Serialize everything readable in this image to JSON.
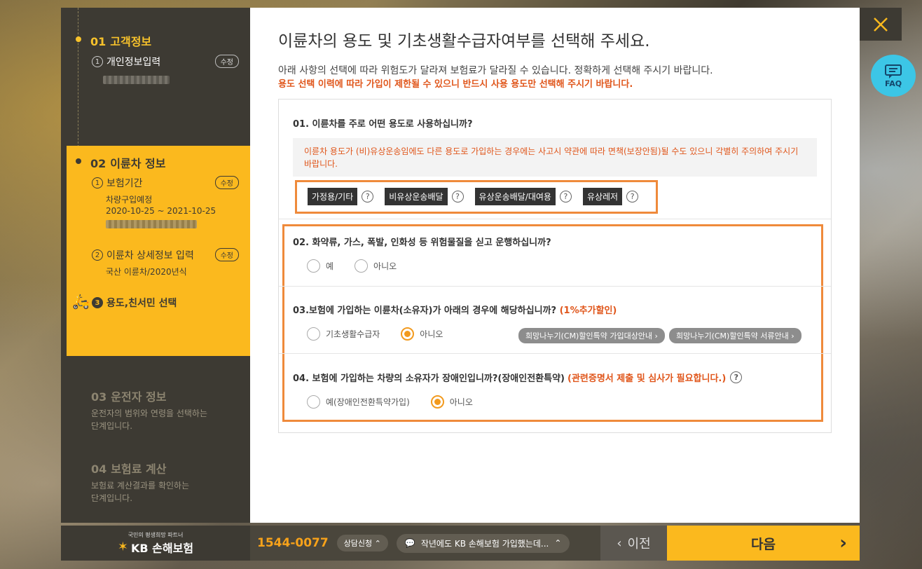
{
  "sidebar": {
    "step1": {
      "num": "01",
      "title": "고객정보",
      "sub_num": "1",
      "sub_label": "개인정보입력",
      "edit": "수정"
    },
    "step2": {
      "num": "02",
      "title": "이륜차 정보",
      "s1_num": "1",
      "s1_label": "보험기간",
      "s1_edit": "수정",
      "s1_line1": "차량구입예정",
      "s1_line2": "2020-10-25 ~ 2021-10-25",
      "s2_num": "2",
      "s2_label": "이륜차 상세정보 입력",
      "s2_edit": "수정",
      "s2_line1": "국산 이륜차/2020년식",
      "s3_num": "3",
      "s3_label": "용도,친서민 선택"
    },
    "step3": {
      "num": "03",
      "title": "운전자 정보",
      "desc1": "운전자의 범위와 연령을 선택하는",
      "desc2": "단계입니다."
    },
    "step4": {
      "num": "04",
      "title": "보험료 계산",
      "desc1": "보험료 계산결과를 확인하는",
      "desc2": "단계입니다."
    }
  },
  "main": {
    "title": "이륜차의 용도 및 기초생활수급자여부를 선택해 주세요.",
    "lead": "아래 사항의 선택에 따라 위험도가 달라져 보험료가 달라질 수 있습니다. 정확하게 선택해 주시기 바랍니다.",
    "lead_warn": "용도 선택 이력에 따라 가입이 제한될 수 있으니 반드시 사용 용도만 선택해 주시기 바랍니다.",
    "q1": "01. 이륜차를 주로 어떤 용도로 사용하십니까?",
    "q1_notice": "이륜차 용도가 (비)유상운송임에도 다른 용도로 가입하는 경우에는 사고시 약관에 따라 면책(보장안됨)될 수도 있으니 각별히 주의하여 주시기 바랍니다.",
    "q1_options": [
      "가정용/기타",
      "비유상운송배달",
      "유상운송배달/대여용",
      "유상레저"
    ],
    "q2": "02. 화약류, 가스, 폭발, 인화성 등 위험물질을 싣고 운행하십니까?",
    "q2_yes": "예",
    "q2_no": "아니오",
    "q3": "03.보험에 가입하는 이륜차(소유자)가 아래의 경우에 해당하십니까?",
    "q3_accent": "(1%추가할인)",
    "q3_opt1": "기초생활수급자",
    "q3_opt2": "아니오",
    "q3_btn1": "희망나누기(CM)할인특약 가입대상안내",
    "q3_btn2": "희망나누기(CM)할인특약 서류안내",
    "q4": "04. 보험에 가입하는 차량의 소유자가 장애인입니까?(장애인전환특약)",
    "q4_accent": "(관련증명서 제출 및 심사가 필요합니다.)",
    "q4_opt1": "예(장애인전환특약가입)",
    "q4_opt2": "아니오"
  },
  "faq": {
    "label": "FAQ"
  },
  "bottom": {
    "tag": "국민의 평생희망 파트너",
    "brand": "KB 손해보험",
    "phone": "1544-0077",
    "consult": "상담신청",
    "chat": "작년에도 KB 손해보험 가입했는데...",
    "prev": "이전",
    "next": "다음"
  }
}
